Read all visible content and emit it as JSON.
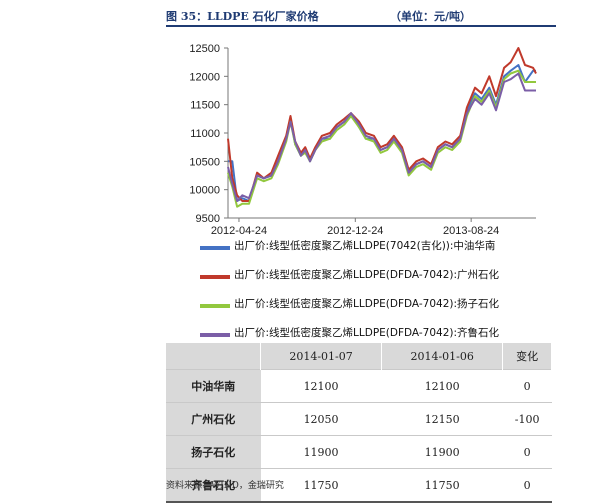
{
  "header": {
    "title": "图 35：LLDPE 石化厂家价格",
    "unit": "（单位：元/吨）"
  },
  "chart_data": {
    "type": "line",
    "x_ticks": [
      "2012-04-24",
      "2012-12-24",
      "2013-08-24"
    ],
    "ylim": [
      9500,
      12500
    ],
    "y_ticks": [
      9500,
      10000,
      10500,
      11000,
      11500,
      12000,
      12500
    ],
    "grid": false,
    "legend_position": "bottom",
    "x": [
      "2012-04-01",
      "2012-04-10",
      "2012-04-20",
      "2012-05-01",
      "2012-05-15",
      "2012-06-01",
      "2012-06-15",
      "2012-07-01",
      "2012-07-15",
      "2012-08-01",
      "2012-08-10",
      "2012-08-20",
      "2012-09-01",
      "2012-09-10",
      "2012-09-20",
      "2012-10-01",
      "2012-10-15",
      "2012-11-01",
      "2012-11-15",
      "2012-12-01",
      "2012-12-15",
      "2013-01-01",
      "2013-01-15",
      "2013-02-01",
      "2013-02-15",
      "2013-03-01",
      "2013-03-15",
      "2013-04-01",
      "2013-04-15",
      "2013-05-01",
      "2013-05-15",
      "2013-06-01",
      "2013-06-15",
      "2013-07-01",
      "2013-07-15",
      "2013-08-01",
      "2013-08-15",
      "2013-09-01",
      "2013-09-15",
      "2013-10-01",
      "2013-10-15",
      "2013-11-01",
      "2013-11-15",
      "2013-12-01",
      "2013-12-15",
      "2014-01-01",
      "2014-01-07"
    ],
    "series": [
      {
        "name": "出厂价:线型低密度聚乙烯LLDPE(7042(吉化)):中油华南",
        "color": "#4472c4",
        "values": [
          10500,
          10500,
          9800,
          9850,
          9800,
          10250,
          10200,
          10250,
          10500,
          10900,
          11250,
          10800,
          10600,
          10700,
          10500,
          10700,
          10900,
          10900,
          11100,
          11200,
          11350,
          11100,
          10900,
          10900,
          10700,
          10750,
          10900,
          10700,
          10300,
          10450,
          10500,
          10400,
          10700,
          10800,
          10750,
          10900,
          11400,
          11700,
          11600,
          11800,
          11500,
          12000,
          12100,
          12200,
          11900,
          12100,
          12100
        ]
      },
      {
        "name": "出厂价:线型低密度聚乙烯LLDPE(DFDA-7042):广州石化",
        "color": "#c0392b",
        "values": [
          10900,
          10200,
          9900,
          9800,
          9800,
          10300,
          10200,
          10300,
          10600,
          10950,
          11300,
          10850,
          10650,
          10750,
          10550,
          10750,
          10950,
          11000,
          11150,
          11250,
          11350,
          11200,
          11000,
          10950,
          10750,
          10800,
          10950,
          10750,
          10350,
          10500,
          10550,
          10450,
          10750,
          10850,
          10800,
          10950,
          11450,
          11800,
          11700,
          12000,
          11650,
          12150,
          12250,
          12500,
          12200,
          12150,
          12050
        ]
      },
      {
        "name": "出厂价:线型低密度聚乙烯LLDPE(DFDA-7042):扬子石化",
        "color": "#92c83e",
        "values": [
          10300,
          10050,
          9700,
          9750,
          9750,
          10200,
          10150,
          10200,
          10450,
          10850,
          11200,
          10800,
          10600,
          10650,
          10500,
          10700,
          10850,
          10900,
          11050,
          11150,
          11300,
          11100,
          10900,
          10850,
          10650,
          10700,
          10850,
          10650,
          10250,
          10400,
          10450,
          10350,
          10650,
          10750,
          10700,
          10850,
          11300,
          11650,
          11550,
          11750,
          11450,
          11950,
          12050,
          12100,
          11900,
          11900,
          11900
        ]
      },
      {
        "name": "出厂价:线型低密度聚乙烯LLDPE(DFDA-7042):齐鲁石化",
        "color": "#7b5ea7",
        "values": [
          10400,
          10100,
          9800,
          9900,
          9850,
          10250,
          10200,
          10250,
          10500,
          10900,
          11200,
          10850,
          10600,
          10700,
          10500,
          10700,
          10900,
          10950,
          11100,
          11200,
          11350,
          11150,
          10950,
          10900,
          10700,
          10750,
          10900,
          10700,
          10300,
          10450,
          10500,
          10400,
          10700,
          10800,
          10750,
          10900,
          11350,
          11600,
          11500,
          11700,
          11400,
          11900,
          11950,
          12050,
          11750,
          11750,
          11750
        ]
      }
    ]
  },
  "table": {
    "headers": [
      "",
      "2014-01-07",
      "2014-01-06",
      "变化"
    ],
    "rows": [
      {
        "name": "中油华南",
        "v1": "12100",
        "v2": "12100",
        "chg": "0"
      },
      {
        "name": "广州石化",
        "v1": "12050",
        "v2": "12150",
        "chg": "-100"
      },
      {
        "name": "扬子石化",
        "v1": "11900",
        "v2": "11900",
        "chg": "0"
      },
      {
        "name": "齐鲁石化",
        "v1": "11750",
        "v2": "11750",
        "chg": "0"
      }
    ]
  },
  "source": "资料来源：WIND，金瑞研究"
}
